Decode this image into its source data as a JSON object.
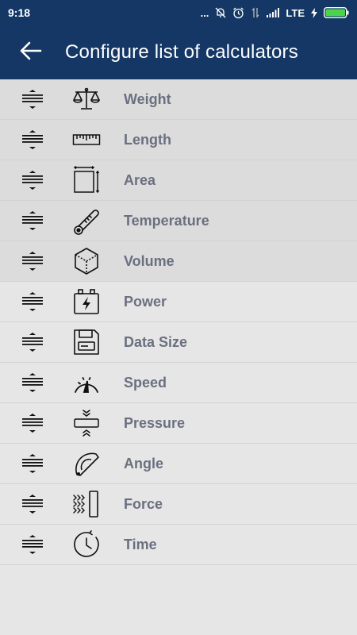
{
  "status_bar": {
    "time": "9:18",
    "dots": "...",
    "network": "LTE"
  },
  "app_bar": {
    "title": "Configure list of calculators",
    "back_icon": "arrow-left-icon"
  },
  "colors": {
    "primary": "#143766",
    "label": "#6a7080",
    "battery": "#4cd34c"
  },
  "calculators": [
    {
      "label": "Weight",
      "icon": "scale-icon"
    },
    {
      "label": "Length",
      "icon": "ruler-icon"
    },
    {
      "label": "Area",
      "icon": "area-icon"
    },
    {
      "label": "Temperature",
      "icon": "thermometer-icon"
    },
    {
      "label": "Volume",
      "icon": "cube-icon"
    },
    {
      "label": "Power",
      "icon": "battery-icon"
    },
    {
      "label": "Data Size",
      "icon": "floppy-disk-icon"
    },
    {
      "label": "Speed",
      "icon": "speedometer-icon"
    },
    {
      "label": "Pressure",
      "icon": "pressure-icon"
    },
    {
      "label": "Angle",
      "icon": "protractor-icon"
    },
    {
      "label": "Force",
      "icon": "force-icon"
    },
    {
      "label": "Time",
      "icon": "clock-icon"
    }
  ]
}
